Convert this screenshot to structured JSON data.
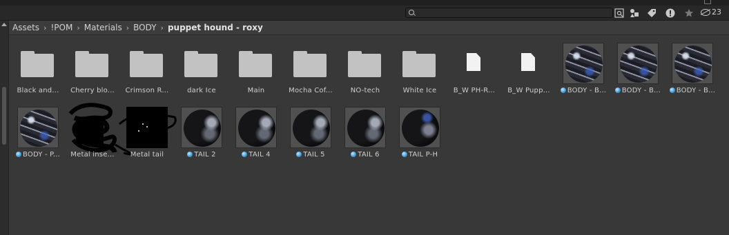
{
  "toolbar": {
    "search": {
      "value": "",
      "placeholder": ""
    },
    "icons": [
      "search-by-type-icon",
      "label-icon",
      "error-filter-icon",
      "favorite-star-icon",
      "hidden-packages-icon"
    ],
    "hidden_count": "23"
  },
  "breadcrumb": [
    "Assets",
    "!POM",
    "Materials",
    "BODY",
    "puppet hound - roxy"
  ],
  "items": [
    {
      "type": "folder",
      "label": "Black and..."
    },
    {
      "type": "folder",
      "label": "Cherry blo..."
    },
    {
      "type": "folder",
      "label": "Crimson R..."
    },
    {
      "type": "folder",
      "label": "dark Ice"
    },
    {
      "type": "folder",
      "label": "Main"
    },
    {
      "type": "folder",
      "label": "Mocha Cof..."
    },
    {
      "type": "folder",
      "label": "NO-tech"
    },
    {
      "type": "folder",
      "label": "White Ice"
    },
    {
      "type": "file",
      "label": "B_W PH-R..."
    },
    {
      "type": "file",
      "label": "B_W Pupp..."
    },
    {
      "type": "material",
      "label": "BODY - B..."
    },
    {
      "type": "material",
      "label": "BODY - B..."
    },
    {
      "type": "material",
      "label": "BODY - B..."
    },
    {
      "type": "material",
      "label": "BODY - P..."
    },
    {
      "type": "redacted",
      "label": "Metal inse..."
    },
    {
      "type": "redacted",
      "label": "Metal tail"
    },
    {
      "type": "material",
      "label": "TAIL 2"
    },
    {
      "type": "material",
      "label": "TAIL 4"
    },
    {
      "type": "material",
      "label": "TAIL 5"
    },
    {
      "type": "material",
      "label": "TAIL 6"
    },
    {
      "type": "material",
      "label": "TAIL P-H"
    }
  ]
}
